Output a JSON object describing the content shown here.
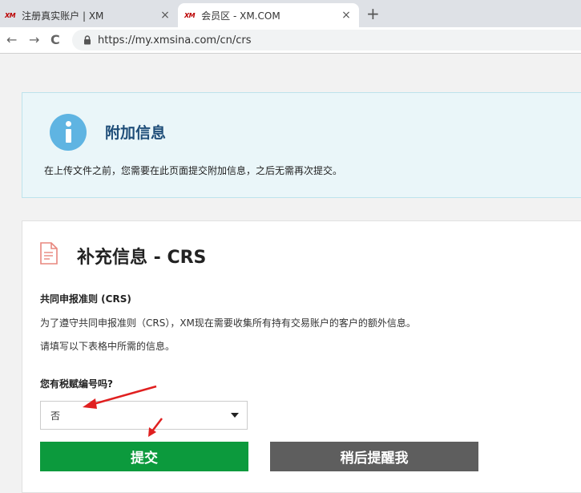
{
  "browser": {
    "tabs": [
      {
        "favicon": "XM",
        "title": "注册真实账户 | XM",
        "close": "×"
      },
      {
        "favicon": "XM",
        "title": "会员区 - XM.COM",
        "close": "×"
      }
    ],
    "new_tab": "+",
    "nav": {
      "back": "←",
      "forward": "→",
      "reload": "C"
    },
    "url": "https://my.xmsina.com/cn/crs"
  },
  "info": {
    "title": "附加信息",
    "text": "在上传文件之前，您需要在此页面提交附加信息，之后无需再次提交。"
  },
  "crs": {
    "title": "补充信息 - CRS",
    "section_label": "共同申报准则 (CRS)",
    "desc1": "为了遵守共同申报准则（CRS），XM现在需要收集所有持有交易账户的客户的额外信息。",
    "desc2": "请填写以下表格中所需的信息。",
    "question": "您有税赋编号吗?",
    "select_value": "否",
    "submit_label": "提交",
    "later_label": "稍后提醒我"
  },
  "colors": {
    "submit": "#0c9a3d",
    "later": "#5e5e5e",
    "info_bg": "#eaf6f9",
    "info_icon": "#5fb4e2",
    "annotation_arrow": "#e02020"
  }
}
